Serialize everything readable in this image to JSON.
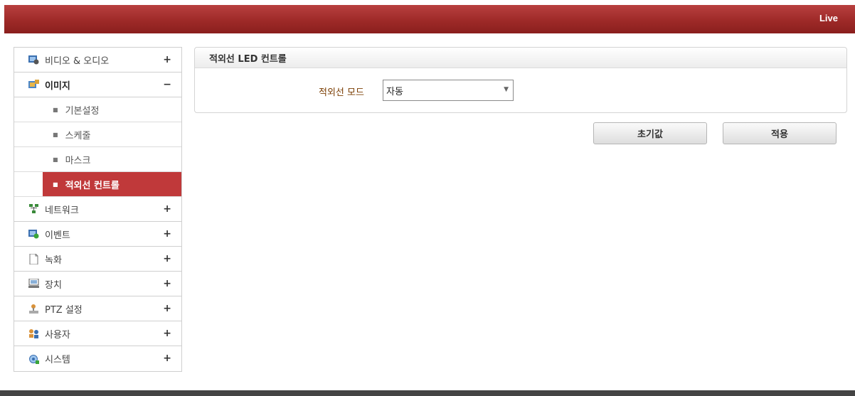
{
  "header": {
    "live_label": "Live",
    "color": "#9e2a28"
  },
  "sidebar": {
    "items": [
      {
        "label": "비디오 & 오디오",
        "toggle": "+",
        "icon": "video-audio-icon"
      },
      {
        "label": "이미지",
        "toggle": "−",
        "icon": "image-icon",
        "open": true,
        "children": [
          {
            "label": "기본설정"
          },
          {
            "label": "스케줄"
          },
          {
            "label": "마스크"
          },
          {
            "label": "적외선 컨트롤",
            "active": true
          }
        ]
      },
      {
        "label": "네트워크",
        "toggle": "+",
        "icon": "network-icon"
      },
      {
        "label": "이벤트",
        "toggle": "+",
        "icon": "event-icon"
      },
      {
        "label": "녹화",
        "toggle": "+",
        "icon": "record-icon"
      },
      {
        "label": "장치",
        "toggle": "+",
        "icon": "device-icon"
      },
      {
        "label": "PTZ 설정",
        "toggle": "+",
        "icon": "ptz-icon"
      },
      {
        "label": "사용자",
        "toggle": "+",
        "icon": "user-icon"
      },
      {
        "label": "시스템",
        "toggle": "+",
        "icon": "system-icon"
      }
    ],
    "active_color": "#c0393a"
  },
  "panel": {
    "title": "적외선 LED 컨트롤",
    "mode_label": "적외선 모드",
    "mode_value": "자동"
  },
  "buttons": {
    "reset": "초기값",
    "apply": "적용"
  }
}
